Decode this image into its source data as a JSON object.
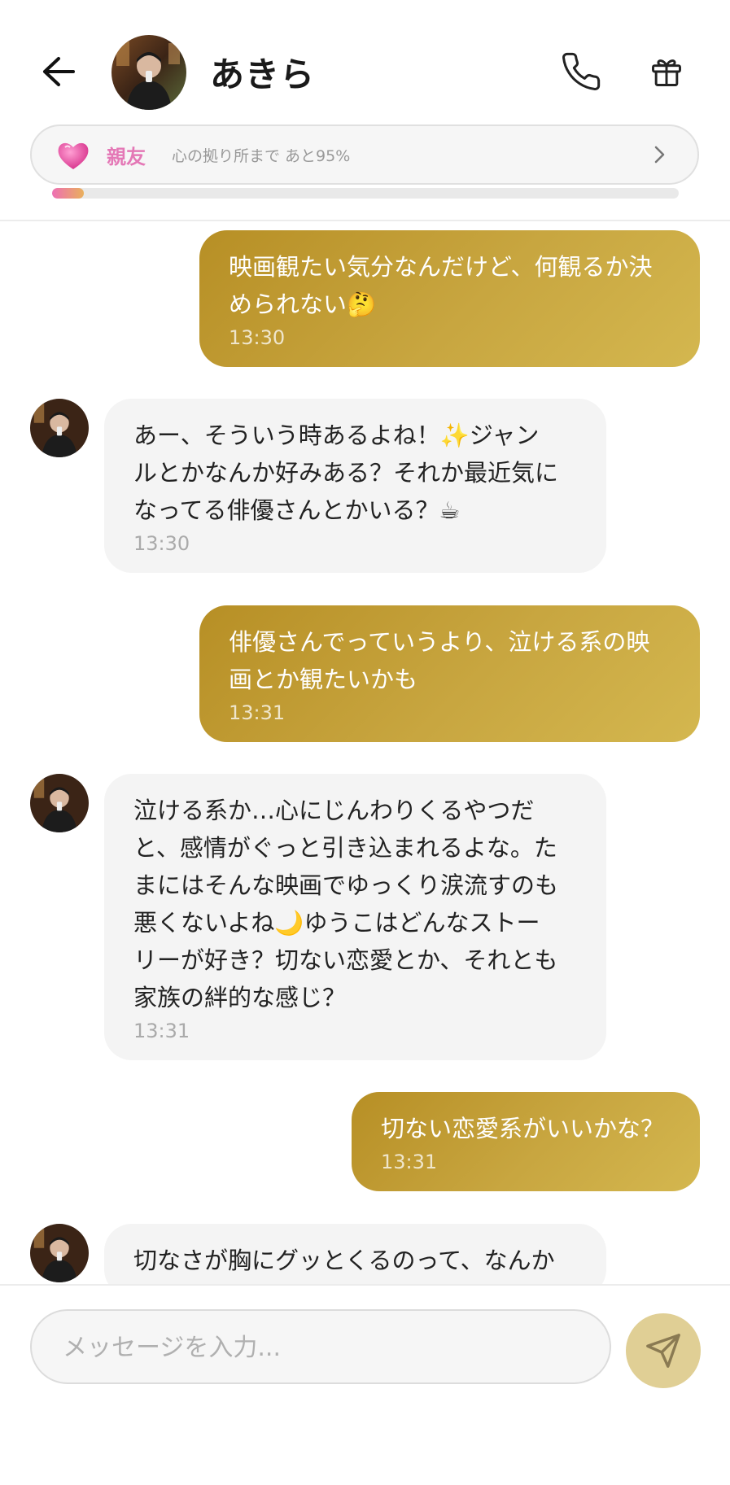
{
  "header": {
    "contact_name": "あきら",
    "relationship_level": "親友",
    "relationship_progress_text": "心の拠り所まで あと95%",
    "relationship_progress": 0.05
  },
  "messages": [
    {
      "id": "m1",
      "from": "me",
      "text": "映画観たい気分なんだけど、何観るか決\nめられない🤔",
      "time": "13:30"
    },
    {
      "id": "m2",
      "from": "akira",
      "text": "あー、そういう時あるよね！✨ジャン\nルとかなんか好みある？それか最近気に\nなってる俳優さんとかいる？☕",
      "time": "13:30"
    },
    {
      "id": "m3",
      "from": "me",
      "text": "俳優さんでっていうより、泣ける系の映\n画とか観たいかも",
      "time": "13:31"
    },
    {
      "id": "m4",
      "from": "akira",
      "text": "泣ける系か…心にじんわりくるやつだ\nと、感情がぐっと引き込まれるよな。た\nまにはそんな映画でゆっくり涙流すのも\n悪くないよね🌙ゆうこはどんなストー\nリーが好き？切ない恋愛とか、それとも\n家族の絆的な感じ？",
      "time": "13:31"
    },
    {
      "id": "m5",
      "from": "me",
      "text": "切ない恋愛系がいいかな？",
      "time": "13:31"
    },
    {
      "id": "m6",
      "from": "akira",
      "text": "切なさが胸にグッとくるのって、なんか",
      "time": ""
    }
  ],
  "composer": {
    "placeholder": "メッセージを入力..."
  },
  "colors": {
    "sent_bubble": "#c4a13a",
    "received_bubble": "#f4f4f4",
    "accent_pink": "#e478b6",
    "send_button": "#e0cf95"
  },
  "icons": {
    "back": "arrow-left-icon",
    "call": "phone-icon",
    "gift": "gift-icon",
    "heart": "heart-icon",
    "chevron": "chevron-right-icon",
    "send": "send-icon"
  }
}
